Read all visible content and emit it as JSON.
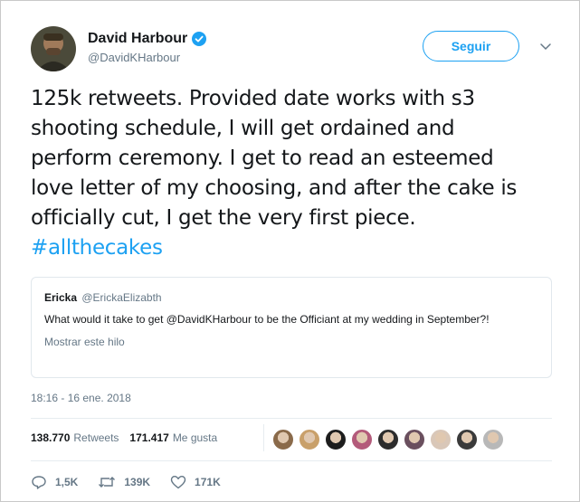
{
  "author": {
    "display_name": "David Harbour",
    "handle": "@DavidKHarbour",
    "verified": true,
    "avatar_icon": "avatar-photo"
  },
  "follow_button": {
    "label": "Seguir"
  },
  "menu_icon": "chevron-down-icon",
  "tweet": {
    "text": "125k retweets.  Provided date works with s3 shooting schedule, I will get ordained and perform ceremony.  I get to read an esteemed love letter of my choosing, and after the cake is officially cut, I get the very first piece. ",
    "hashtag": "#allthecakes"
  },
  "quoted_tweet": {
    "name": "Ericka",
    "handle": "@ErickaElizabth",
    "text": "What would it take to get @DavidKHarbour to be the Officiant at my wedding in September?!",
    "show_thread": "Mostrar este hilo"
  },
  "timestamp": "18:16 - 16 ene. 2018",
  "stats": {
    "retweets_count": "138.770",
    "retweets_label": "Retweets",
    "likes_count": "171.417",
    "likes_label": "Me gusta"
  },
  "likers": [
    "#8a6a4a",
    "#c9a06a",
    "#1d1d1d",
    "#b35a7a",
    "#2c2c2c",
    "#6a4f5e",
    "#d9c7b8",
    "#3a3a3a",
    "#b8b8b8"
  ],
  "actions": {
    "reply_count": "1,5K",
    "retweet_count": "139K",
    "like_count": "171K"
  },
  "colors": {
    "accent": "#1da1f2",
    "muted": "#657786"
  }
}
